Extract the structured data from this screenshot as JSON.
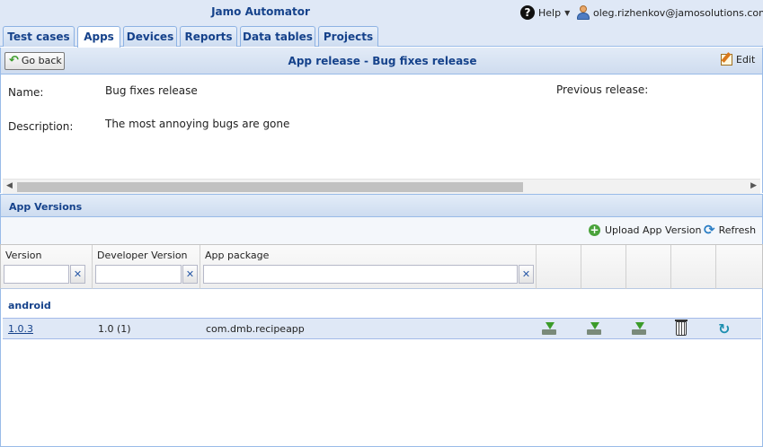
{
  "header": {
    "app_title": "Jamo Automator",
    "help_label": "Help",
    "user_email": "oleg.rizhenkov@jamosolutions.com"
  },
  "tabs": [
    {
      "label": "Test cases",
      "active": false
    },
    {
      "label": "Apps",
      "active": true
    },
    {
      "label": "Devices",
      "active": false
    },
    {
      "label": "Reports",
      "active": false
    },
    {
      "label": "Data tables",
      "active": false
    },
    {
      "label": "Projects",
      "active": false
    }
  ],
  "panel": {
    "go_back_label": "Go back",
    "title": "App release - Bug fixes release",
    "edit_label": "Edit"
  },
  "details": {
    "name_label": "Name:",
    "name_value": "Bug fixes release",
    "previous_release_label": "Previous release:",
    "description_label": "Description:",
    "description_value": "The most annoying bugs are gone"
  },
  "versions": {
    "section_title": "App Versions",
    "upload_label": "Upload App Version",
    "refresh_label": "Refresh",
    "columns": [
      "Version",
      "Developer Version",
      "App package"
    ],
    "filter_clear_glyph": "✕",
    "group_name": "android",
    "rows": [
      {
        "version": "1.0.3",
        "developer_version": "1.0 (1)",
        "app_package": "com.dmb.recipeapp"
      }
    ]
  },
  "colors": {
    "header_bg": "#dfe8f6",
    "title_blue": "#15428b",
    "border_blue": "#99bbe8",
    "row_selected": "#dfe8f6"
  }
}
